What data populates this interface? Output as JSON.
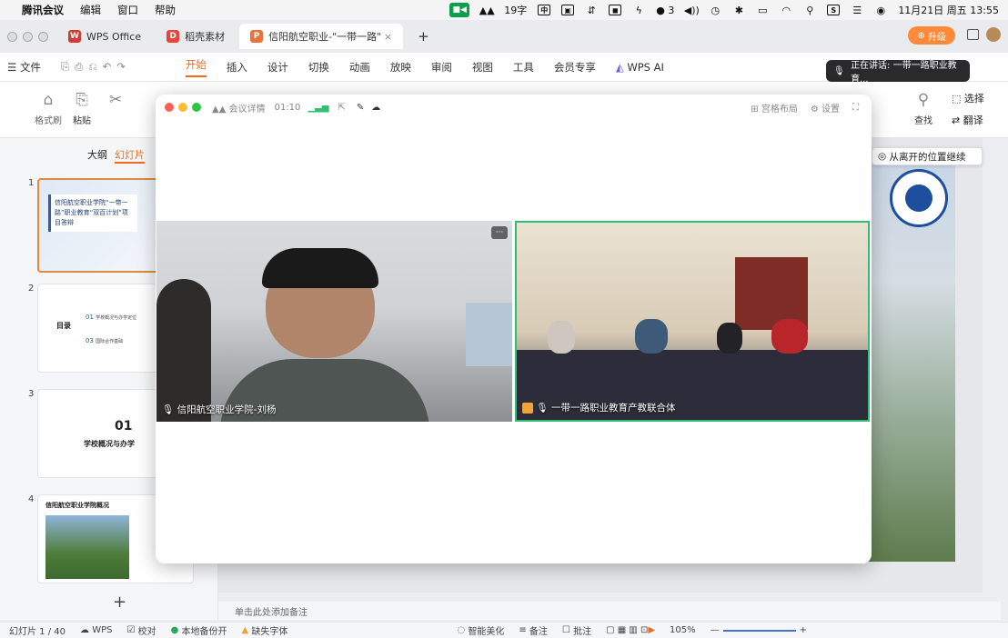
{
  "menubar": {
    "app": "腾讯会议",
    "items": [
      "编辑",
      "窗口",
      "帮助"
    ],
    "input_count": "19字",
    "wechat_count": "3",
    "datetime": "11月21日 周五 13:55"
  },
  "tabbar": {
    "tabs": [
      {
        "label": "WPS Office",
        "logo": "W",
        "logo_color": "#d33a30"
      },
      {
        "label": "稻壳素材",
        "logo": "D",
        "logo_color": "#e8453c"
      },
      {
        "label": "信阳航空职业-\"一带一路\"",
        "logo": "P",
        "logo_color": "#e8743b"
      }
    ],
    "new_tab": "+",
    "upgrade": "升级"
  },
  "menurow": {
    "file": "文件",
    "items": [
      "开始",
      "插入",
      "设计",
      "切换",
      "动画",
      "放映",
      "审阅",
      "视图",
      "工具",
      "会员专享"
    ],
    "active": "开始",
    "ai": "WPS AI"
  },
  "ribbon": {
    "format_painter": "格式刷",
    "paste": "粘贴",
    "find": "查找",
    "select": "选择",
    "translate": "翻译"
  },
  "leftpanel": {
    "tabs": [
      "大纲",
      "幻灯片"
    ],
    "slides": [
      {
        "no": "1",
        "text": "信阳航空职业学院“一带一路”职业教育“双百计划”项目答辩"
      },
      {
        "no": "2",
        "title": "目录",
        "item1": "01",
        "item1_text": "学校概况与办学定位",
        "item2": "03",
        "item2_text": "国际合作基础"
      },
      {
        "no": "3",
        "big": "01",
        "sub": "学校概况与办学"
      },
      {
        "no": "4",
        "title": "信阳航空职业学院概况"
      }
    ],
    "add": "+"
  },
  "notes_placeholder": "单击此处添加备注",
  "statusbar": {
    "slide": "幻灯片 1 / 40",
    "wps": "WPS",
    "proof": "校对",
    "backup": "本地备份开",
    "missing_font": "缺失字体",
    "beautify": "智能美化",
    "notes": "备注",
    "comments": "批注",
    "zoom": "105%"
  },
  "speaking": "正在讲话: 一带一路职业教育...",
  "resume": "从离开的位置继续",
  "meeting": {
    "details": "会议详情",
    "timer": "01:10",
    "layout": "宫格布局",
    "settings": "设置",
    "participants": [
      {
        "name": "信阳航空职业学院-刘杨"
      },
      {
        "name": "一带一路职业教育产教联合体"
      }
    ],
    "more": "···"
  },
  "colors": {
    "accent": "#f26b1d",
    "meeting_active": "#2fbf71"
  }
}
